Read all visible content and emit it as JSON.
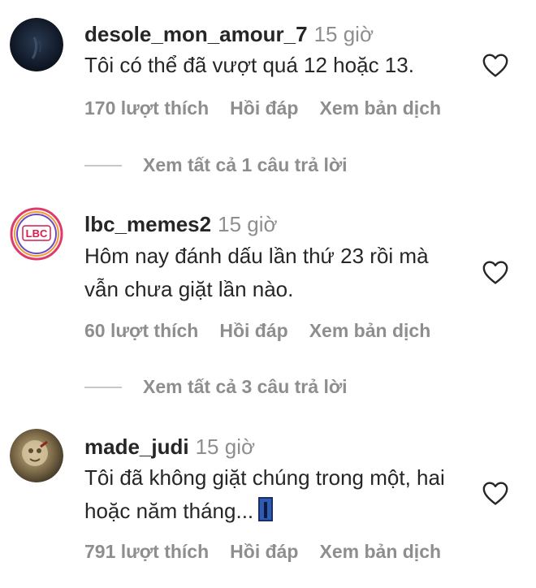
{
  "comments": [
    {
      "username": "desole_mon_amour_7",
      "time": "15 giờ",
      "text": "Tôi có thể đã vượt quá 12 hoặc 13.",
      "text_suffix": "",
      "likes": "170 lượt thích",
      "reply": "Hồi đáp",
      "translate": "Xem bản dịch",
      "view_replies": "Xem tất cả 1 câu trả lời"
    },
    {
      "username": "lbc_memes2",
      "time": "15 giờ",
      "text": "Hôm nay đánh dấu lần thứ 23 rồi mà vẫn chưa giặt lần nào.",
      "text_suffix": "",
      "likes": "60 lượt thích",
      "reply": "Hồi đáp",
      "translate": "Xem bản dịch",
      "view_replies": "Xem tất cả 3 câu trả lời"
    },
    {
      "username": "made_judi",
      "time": "15 giờ",
      "text": "Tôi đã không giặt chúng trong một, hai hoặc năm tháng...",
      "emoji": "jeans-emoji",
      "likes": "791 lượt thích",
      "reply": "Hồi đáp",
      "translate": "Xem bản dịch"
    }
  ],
  "avatars": {
    "c0": {
      "logo_text": ""
    },
    "c1": {
      "logo_text": "LBC"
    }
  },
  "icons": {
    "like": "heart-outline-icon"
  },
  "colors": {
    "text": "#262626",
    "secondary": "#8e8e8e",
    "divider": "#c7c7c7"
  }
}
